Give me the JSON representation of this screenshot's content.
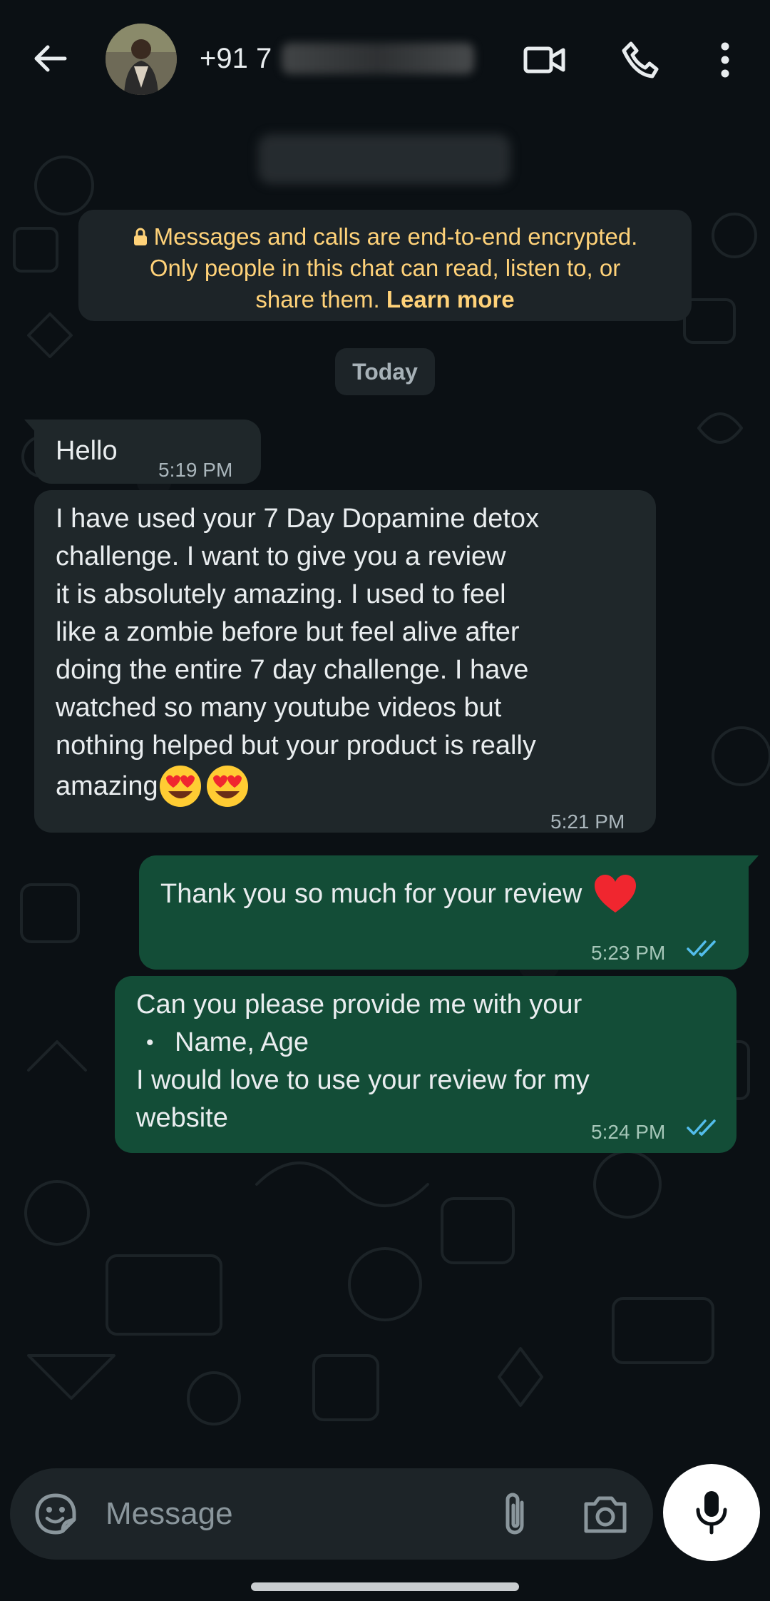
{
  "header": {
    "contact_number": "+91 7",
    "icons": [
      "back-arrow-icon",
      "video-call-icon",
      "voice-call-icon",
      "more-options-icon"
    ]
  },
  "encryption_notice": {
    "line1": "Messages and calls are end-to-end encrypted.",
    "line2": "Only people in this chat can read, listen to, or",
    "line3_text": "share them.",
    "learn_more": "Learn more"
  },
  "date_divider": "Today",
  "messages": [
    {
      "direction": "incoming",
      "lines": [
        "Hello"
      ],
      "time": "5:19 PM"
    },
    {
      "direction": "incoming",
      "lines": [
        "I have used your 7 Day Dopamine detox",
        "challenge. I want to give you a review",
        "it is absolutely amazing. I used to feel",
        "like a zombie before but feel alive after",
        "doing the entire 7 day challenge. I have",
        "watched so many youtube videos but",
        "nothing helped but your product is really",
        "amazing"
      ],
      "emoji": "heart-eyes-emoji x2",
      "time": "5:21 PM"
    },
    {
      "direction": "outgoing",
      "lines": [
        "Thank you so much for your review"
      ],
      "emoji": "red-heart-emoji",
      "time": "5:23 PM",
      "status": "read"
    },
    {
      "direction": "outgoing",
      "lines": [
        "Can you please provide me with your",
        "Name, Age",
        "I would love to use your review for my",
        "website"
      ],
      "bullet": "•",
      "time": "5:24 PM",
      "status": "read"
    }
  ],
  "composer": {
    "placeholder": "Message",
    "icons": [
      "sticker-icon",
      "attach-icon",
      "camera-icon",
      "mic-icon"
    ]
  },
  "colors": {
    "background": "#0b1014",
    "incoming_bubble": "#1f272a",
    "outgoing_bubble": "#134d37",
    "notice_text": "#ffd279",
    "read_ticks": "#53bdeb"
  }
}
